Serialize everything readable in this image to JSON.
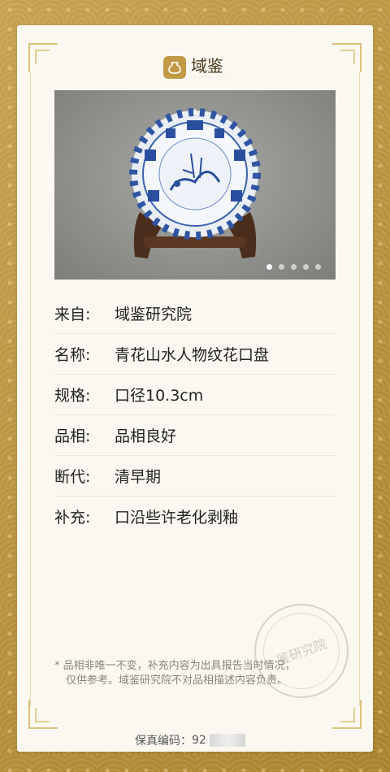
{
  "brand": {
    "name": "域鉴",
    "icon": "pot-icon",
    "accent": "#c29a46"
  },
  "carousel": {
    "icon": "porcelain-plate-photo",
    "dots": 5,
    "active_index": 0
  },
  "details": [
    {
      "label": "来自:",
      "value": "域鉴研究院"
    },
    {
      "label": "名称:",
      "value": "青花山水人物纹花口盘"
    },
    {
      "label": "规格:",
      "value": "口径10.3cm"
    },
    {
      "label": "品相:",
      "value": "品相良好"
    },
    {
      "label": "断代:",
      "value": "清早期"
    },
    {
      "label": "补充:",
      "value": "口沿些许老化剥釉"
    }
  ],
  "note": {
    "line1": "* 品相非唯一不变，补充内容为出具报告当时情况，",
    "line2": "仅供参考。域鉴研究院不对品相描述内容负责。"
  },
  "seal": {
    "text": "鉴研究院",
    "icon": "seal-stamp"
  },
  "serial": {
    "label": "保真编码：",
    "visible_prefix": "92"
  }
}
